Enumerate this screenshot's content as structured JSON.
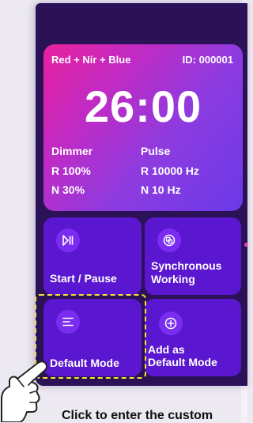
{
  "timer": {
    "mode": "Red + Nir + Blue",
    "device_id": "ID: 000001",
    "time": "26:00",
    "left_header": "Dimmer",
    "right_header": "Pulse",
    "left_row1": "R 100%",
    "left_row2": "N 30%",
    "right_row1": "R 10000 Hz",
    "right_row2": "N 10 Hz"
  },
  "tiles": {
    "start_pause": {
      "label": "Start / Pause",
      "icon": "play-pause-icon"
    },
    "synchronous": {
      "label_line1": "Synchronous",
      "label_line2": "Working",
      "icon": "sync-copy-icon"
    },
    "default_mode": {
      "label": "Default Mode",
      "icon": "menu-lines-icon"
    },
    "add_default": {
      "label_line1": "Add as",
      "label_line2": "Default Mode",
      "icon": "plus-circle-icon"
    }
  },
  "hint": {
    "text": "Click to enter the custom"
  },
  "colors": {
    "device_bg": "#2b1257",
    "tile_bg": "#5a17cf",
    "icon_circle": "#7a2df0",
    "card_gradient_start": "#e8219e",
    "card_gradient_end": "#6b3ae8",
    "highlight_dash": "#f5e23a"
  }
}
